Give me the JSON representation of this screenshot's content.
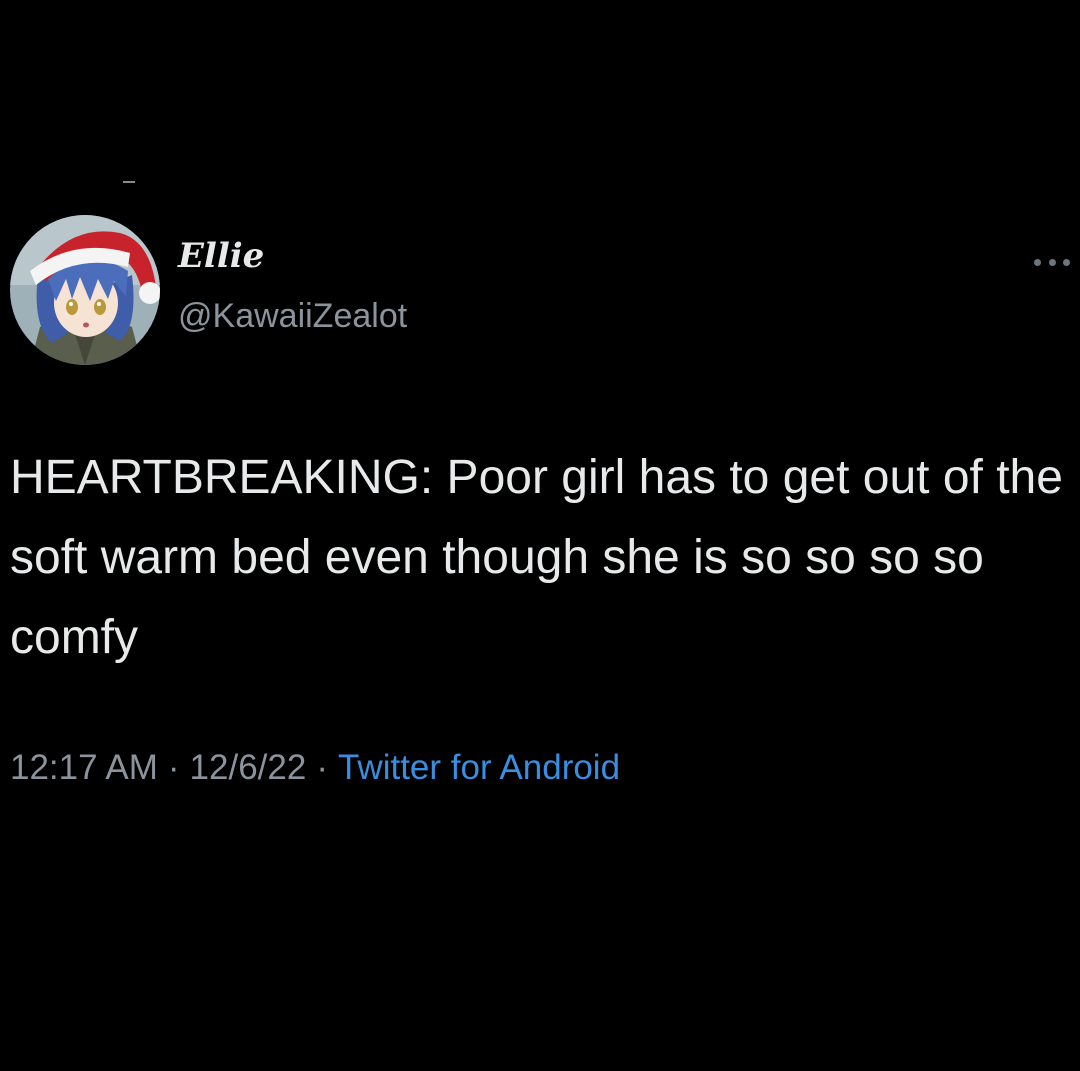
{
  "tweet": {
    "author": {
      "display_name": "Ellie",
      "handle": "@KawaiiZealot",
      "avatar_icon": "anime-avatar-santa-hat"
    },
    "more_icon": "ellipsis-icon",
    "text": "HEARTBREAKING: Poor girl has to get out of the soft warm bed even though she is so so so so comfy",
    "time": "12:17 AM",
    "separator": "·",
    "date": "12/6/22",
    "source": "Twitter for Android"
  },
  "colors": {
    "background": "#000000",
    "text_primary": "#e7e9ea",
    "text_secondary": "#8b949c",
    "link": "#3a8ee0",
    "hat_red": "#c8232c"
  }
}
